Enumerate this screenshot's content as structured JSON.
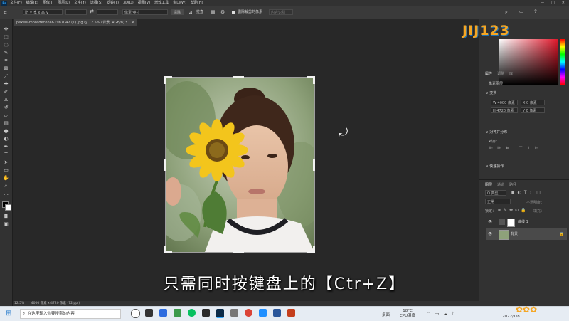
{
  "menubar": {
    "app_logo": "Ps",
    "items": [
      "文件(F)",
      "编辑(E)",
      "图像(I)",
      "图层(L)",
      "文字(Y)",
      "选择(S)",
      "滤镜(T)",
      "3D(D)",
      "视图(V)",
      "增效工具",
      "窗口(W)",
      "帮助(H)"
    ]
  },
  "optbar": {
    "ratio_select": "比 ∨ 宽 x 高 ∨",
    "unit_select": "像素/英寸",
    "clear_button": "清除",
    "straighten_label": "拉直",
    "delete_crop_label": "删除裁剪的像素",
    "fill_label": "内容识别"
  },
  "document": {
    "tab_title": "pexels-moosdecohar-1987042 (1).jpg @ 12.5% (背景, RGB/8) *"
  },
  "right_panel": {
    "top_tabs": [
      "属性",
      "调整",
      "库"
    ],
    "section_pixel_layer": "像素图层",
    "section_transform": "变换",
    "transform_w": "W 4000 像素",
    "transform_h": "H 4720 像素",
    "transform_x": "X 0 像素",
    "transform_y": "Y 0 像素",
    "section_align": "对齐并分布",
    "align_label": "对齐：",
    "section_quick": "快速操作",
    "layer_tabs": [
      "图层",
      "通道",
      "路径"
    ],
    "layer_kind": "Q 类型",
    "blend_mode": "正常",
    "opacity_label": "不透明度：",
    "lock_label": "锁定：",
    "fill_label": "填充：",
    "layers": [
      {
        "name": "曲线 1"
      },
      {
        "name": "背景"
      }
    ]
  },
  "subtitle": "只需同时按键盘上的【Ctr+Z】",
  "statusbar": {
    "zoom": "12.5%",
    "doc_size": "4000 像素 x 4720 像素 (72 ppi)"
  },
  "taskbar": {
    "search_placeholder": "在这里输入你要搜索的内容",
    "weather": "18°C",
    "cpu": "CPU温度",
    "desktop": "桌面",
    "date": "2022/1/8"
  },
  "watermark": "JIJ123"
}
